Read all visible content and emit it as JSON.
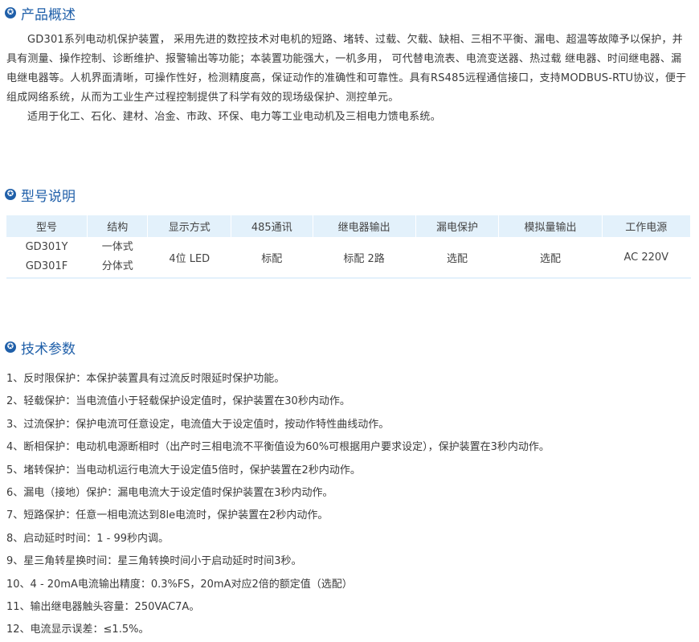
{
  "sections": {
    "overview_title": "产品概述",
    "model_title": "型号说明",
    "params_title": "技术参数"
  },
  "overview": {
    "p1": "GD301系列电动机保护装置， 采用先进的数控技术对电机的短路、堵转、过载、欠载、缺相、三相不平衡、漏电、超温等故障予以保护，并具有测量、操作控制、诊断维护、报警输出等功能；本装置功能强大，一机多用， 可代替电流表、电流变送器、热过载 继电器、时间继电器、漏电继电器等。人机界面清晰，可操作性好，检测精度高，保证动作的准确性和可靠性。具有RS485远程通信接口，支持MODBUS-RTU协议，便于组成网络系统，从而为工业生产过程控制提供了科学有效的现场级保护、测控单元。",
    "p2": "适用于化工、石化、建材、冶金、市政、环保、电力等工业电动机及三相电力馈电系统。"
  },
  "model_table": {
    "headers": [
      "型号",
      "结构",
      "显示方式",
      "485通讯",
      "继电器输出",
      "漏电保护",
      "模拟量输出",
      "工作电源"
    ],
    "models": [
      "GD301Y",
      "GD301F"
    ],
    "structures": [
      "一体式",
      "分体式"
    ],
    "display": "4位 LED",
    "rs485": "标配",
    "relay": "标配 2路",
    "leakage": "选配",
    "analog": "选配",
    "power": "AC 220V"
  },
  "params": [
    "1、反时限保护：本保护装置具有过流反时限延时保护功能。",
    "2、轻载保护：当电流值小于轻载保护设定值时，保护装置在30秒内动作。",
    "3、过流保护：保护电流可任意设定，电流值大于设定值时，按动作特性曲线动作。",
    "4、断相保护：电动机电源断相时（出产时三相电流不平衡值设为60%可根据用户要求设定），保护装置在3秒内动作。",
    "5、堵转保护：当电动机运行电流大于设定值5倍时，保护装置在2秒内动作。",
    "6、漏电（接地）保护：漏电电流大于设定值时保护装置在3秒内动作。",
    "7、短路保护：任意一相电流达到8le电流时，保护装置在2秒内动作。",
    "8、启动延时时间：1 - 99秒内调。",
    "9、星三角转星换时间：星三角转换时间小于启动延时时间3秒。",
    "10、4 - 20mA电流输出精度：0.3%FS，20mA对应2倍的额定值（选配）",
    "11、输出继电器触头容量：250VAC7A。",
    "12、电流显示误差：≤1.5%。"
  ]
}
